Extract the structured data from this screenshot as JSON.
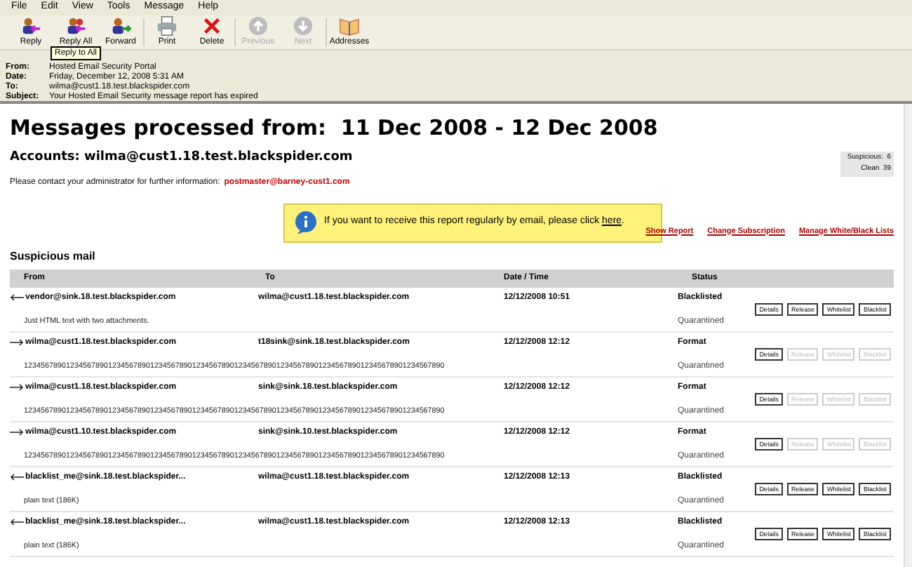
{
  "menu": [
    "File",
    "Edit",
    "View",
    "Tools",
    "Message",
    "Help"
  ],
  "toolbar": [
    {
      "label": "Reply",
      "kind": "reply",
      "disabled": false
    },
    {
      "label": "Reply All",
      "kind": "replyall",
      "disabled": false
    },
    {
      "label": "Forward",
      "kind": "forward",
      "disabled": false
    },
    {
      "label": "Print",
      "kind": "print",
      "disabled": false
    },
    {
      "label": "Delete",
      "kind": "delete",
      "disabled": false
    },
    {
      "label": "Previous",
      "kind": "previous",
      "disabled": true
    },
    {
      "label": "Next",
      "kind": "next",
      "disabled": true
    },
    {
      "label": "Addresses",
      "kind": "addresses",
      "disabled": false
    }
  ],
  "tooltip": "Reply to All",
  "header": [
    {
      "label": "From:",
      "value": "Hosted Email Security Portal"
    },
    {
      "label": "Date:",
      "value": "Friday, December 12, 2008 5:31 AM"
    },
    {
      "label": "To:",
      "value": "wilma@cust1.18.test.blackspider.com"
    },
    {
      "label": "Subject:",
      "value": "Your Hosted Email Security message report has expired"
    }
  ],
  "report": {
    "title": "Messages processed from:  11 Dec 2008 - 12 Dec 2008",
    "accounts": "Accounts: wilma@cust1.18.test.blackspider.com",
    "contact": "Please contact your administrator for further information:",
    "contact_email": "postmaster@barney-cust1.com",
    "counts": [
      {
        "label": "Suspicious:",
        "value": "6"
      },
      {
        "label": "Clean",
        "value": "39"
      }
    ],
    "notice": "If you want to receive this report regularly by email, please click ",
    "notice_link": "here",
    "notice_end": ".",
    "links": [
      "Show Report",
      "Change Subscription",
      "Manage White/Black Lists"
    ],
    "section": "Suspicious mail",
    "columns": [
      "From",
      "To",
      "Date / Time",
      "Status"
    ],
    "rows": [
      {
        "kind": "incoming",
        "from": "vendor@sink.18.test.blackspider.com",
        "to": "wilma@cust1.18.test.blackspider.com",
        "date": "12/12/2008 10:51",
        "status": "Blacklisted",
        "state": "Quarantined",
        "subject": "Just HTML text with two attachments.",
        "actions": [
          {
            "label": "Details",
            "disabled": false
          },
          {
            "label": "Release",
            "disabled": false
          },
          {
            "label": "Whitelist",
            "disabled": false
          },
          {
            "label": "Blacklist",
            "disabled": false
          }
        ]
      },
      {
        "kind": "outgoing",
        "from": "wilma@cust1.18.test.blackspider.com",
        "to": "t18sink@sink.18.test.blackspider.com",
        "date": "12/12/2008 12:12",
        "status": "Format",
        "state": "Quarantined",
        "subject": "1234567890123456789012345678901234567890123456789012345678901234567890123456789012345678901234567890",
        "actions": [
          {
            "label": "Details",
            "disabled": false
          },
          {
            "label": "Release",
            "disabled": true
          },
          {
            "label": "Whitelist",
            "disabled": true
          },
          {
            "label": "Blacklist",
            "disabled": true
          }
        ]
      },
      {
        "kind": "outgoing",
        "from": "wilma@cust1.18.test.blackspider.com",
        "to": "sink@sink.18.test.blackspider.com",
        "date": "12/12/2008 12:12",
        "status": "Format",
        "state": "Quarantined",
        "subject": "1234567890123456789012345678901234567890123456789012345678901234567890123456789012345678901234567890",
        "actions": [
          {
            "label": "Details",
            "disabled": false
          },
          {
            "label": "Release",
            "disabled": true
          },
          {
            "label": "Whitelist",
            "disabled": true
          },
          {
            "label": "Blacklist",
            "disabled": true
          }
        ]
      },
      {
        "kind": "outgoing",
        "from": "wilma@cust1.10.test.blackspider.com",
        "to": "sink@sink.10.test.blackspider.com",
        "date": "12/12/2008 12:12",
        "status": "Format",
        "state": "Quarantined",
        "subject": "1234567890123456789012345678901234567890123456789012345678901234567890123456789012345678901234567890",
        "actions": [
          {
            "label": "Details",
            "disabled": false
          },
          {
            "label": "Release",
            "disabled": true
          },
          {
            "label": "Whitelist",
            "disabled": true
          },
          {
            "label": "Blacklist",
            "disabled": true
          }
        ]
      },
      {
        "kind": "incoming",
        "from": "blacklist_me@sink.18.test.blackspider...",
        "to": "wilma@cust1.18.test.blackspider.com",
        "date": "12/12/2008 12:13",
        "status": "Blacklisted",
        "state": "Quarantined",
        "subject": "plain text (186K)",
        "actions": [
          {
            "label": "Details",
            "disabled": false
          },
          {
            "label": "Release",
            "disabled": false
          },
          {
            "label": "Whitelist",
            "disabled": false
          },
          {
            "label": "Blacklist",
            "disabled": false
          }
        ]
      },
      {
        "kind": "incoming",
        "from": "blacklist_me@sink.18.test.blackspider...",
        "to": "wilma@cust1.18.test.blackspider.com",
        "date": "12/12/2008 12:13",
        "status": "Blacklisted",
        "state": "Quarantined",
        "subject": "plain text (186K)",
        "actions": [
          {
            "label": "Details",
            "disabled": false
          },
          {
            "label": "Release",
            "disabled": false
          },
          {
            "label": "Whitelist",
            "disabled": false
          },
          {
            "label": "Blacklist",
            "disabled": false
          }
        ]
      }
    ]
  }
}
